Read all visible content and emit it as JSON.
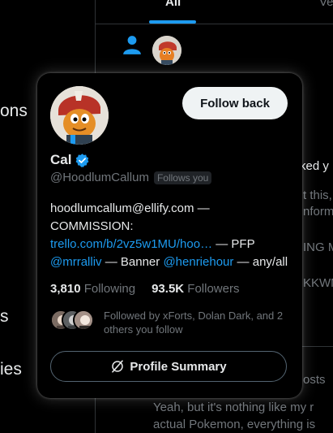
{
  "colors": {
    "background": "#000000",
    "accent": "#1d9bf0",
    "text_primary": "#e7e9ea",
    "text_secondary": "#71767b",
    "border": "#2f3336",
    "follow_button_bg": "#eff3f4"
  },
  "background": {
    "left_nav_fragments": [
      "ons",
      "s",
      "ies"
    ],
    "tabs": [
      {
        "label": "All",
        "active": true
      },
      {
        "label": "Ve",
        "active": false
      }
    ],
    "notification": {
      "icon": "person-icon",
      "fragments": [
        "ked y",
        "t this,",
        "nform",
        "ING M",
        "KKWM",
        "osts"
      ]
    },
    "reply": {
      "line1": "Yeah, but it's nothing like my r",
      "line2": "actual Pokemon, everything is"
    }
  },
  "hovercard": {
    "display_name": "Cal",
    "verified_icon": "verified-badge-icon",
    "handle": "@HoodlumCallum",
    "follows_you": "Follows you",
    "follow_button": "Follow back",
    "bio": {
      "email": "hoodlumcallum@ellify.com",
      "dash1": " — ",
      "commission": "COMMISSION: ",
      "trello_link": "trello.com/b/2vz5w1MU/hoo…",
      "pfp": " — PFP ",
      "pfp_link": "@mrralliv",
      "banner": " — Banner ",
      "banner_link": "@henriehour",
      "tail": " — any/all"
    },
    "stats": {
      "following_count": "3,810",
      "following_label": "Following",
      "followers_count": "93.5K",
      "followers_label": "Followers"
    },
    "followed_by": "Followed by xForts, Dolan Dark, and 2 others you follow",
    "summary_button": "Profile Summary",
    "summary_icon": "grok-icon"
  }
}
